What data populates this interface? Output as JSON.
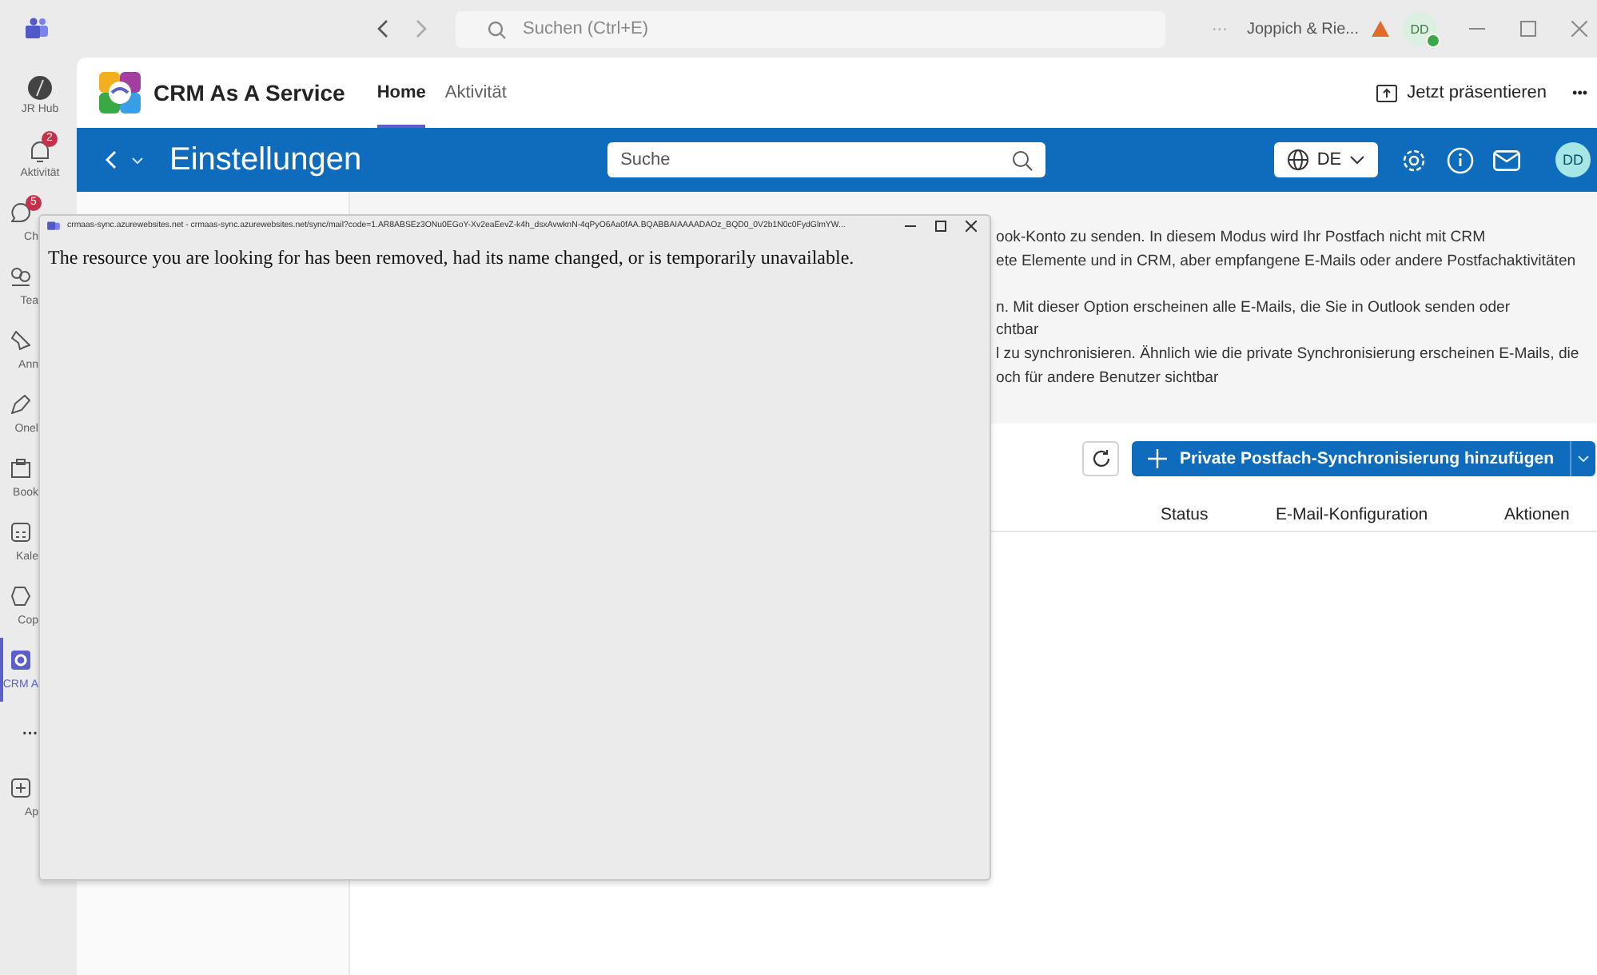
{
  "titlebar": {
    "search_placeholder": "Suchen (Ctrl+E)",
    "more": "···",
    "org": "Joppich & Rie...",
    "avatar": "DD"
  },
  "rail": [
    {
      "label": "JR Hub",
      "selected": false
    },
    {
      "label": "Aktivität",
      "badge": "2",
      "selected": false
    },
    {
      "label": "Ch",
      "badge": "5",
      "selected": false
    },
    {
      "label": "Tea",
      "selected": false
    },
    {
      "label": "Ann",
      "selected": false
    },
    {
      "label": "Onel",
      "selected": false
    },
    {
      "label": "Book",
      "selected": false
    },
    {
      "label": "Kale",
      "selected": false
    },
    {
      "label": "Cop",
      "selected": false
    },
    {
      "label": "CRM A",
      "selected": true
    },
    {
      "label": "···",
      "selected": false
    },
    {
      "label": "Ap",
      "selected": false
    }
  ],
  "app": {
    "name": "CRM As A Service",
    "tabs": [
      {
        "label": "Home",
        "selected": true
      },
      {
        "label": "Aktivität",
        "selected": false
      }
    ],
    "present": "Jetzt präsentieren",
    "more": "•••"
  },
  "bar": {
    "title": "Einstellungen",
    "search_placeholder": "Suche",
    "language": "DE",
    "avatar": "DD"
  },
  "description": [
    [
      "ook-Konto zu senden. In diesem Modus wird Ihr Postfach nicht mit CRM",
      "ete Elemente und in CRM, aber empfangene E-Mails oder andere Postfachaktivitäten"
    ],
    [
      "n. Mit dieser Option erscheinen alle E-Mails, die Sie in Outlook senden oder",
      "chtbar",
      "l zu synchronisieren. Ähnlich wie die private Synchronisierung erscheinen E-Mails, die",
      "och für andere Benutzer sichtbar"
    ]
  ],
  "add_button": "Private Postfach-Synchronisierung hinzufügen",
  "columns": [
    "Status",
    "E-Mail-Konfiguration",
    "Aktionen"
  ],
  "popup": {
    "title": "crmaas-sync.azurewebsites.net - crmaas-sync.azurewebsites.net/sync/mail?code=1.AR8ABSEz3ONu0EGoY-Xv2eaEevZ-k4h_dsxAvwknN-4qPyO6Aa0fAA.BQABBAIAAAADAOz_BQD0_0V2b1N0c0FydGlmYW...",
    "message": "The resource you are looking for has been removed, had its name changed, or is temporarily unavailable."
  }
}
